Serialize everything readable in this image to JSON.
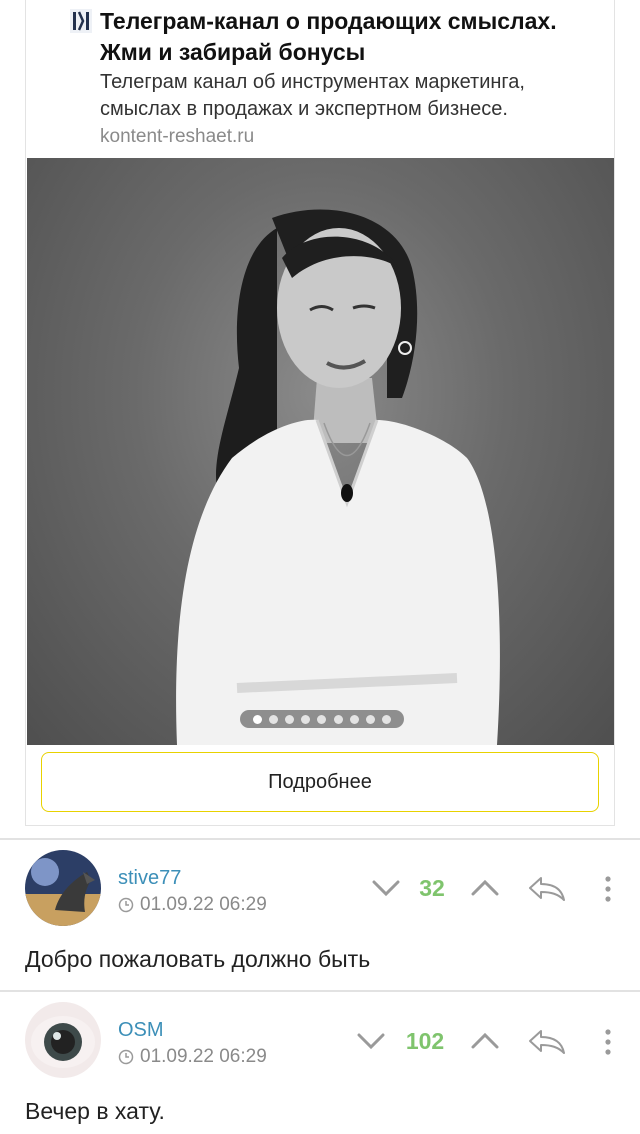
{
  "ad": {
    "title": "Телеграм-канал о продающих смыслах. Жми и забирай бонусы",
    "description": "Телеграм канал об инструментах маркетинга, смыслах в продажах и экспертном бизнесе.",
    "domain": "kontent-reshaet.ru",
    "button_label": "Подробнее",
    "carousel": {
      "count": 9,
      "active_index": 0
    }
  },
  "comments": [
    {
      "username": "stive77",
      "timestamp": "01.09.22 06:29",
      "score": "32",
      "text": "Добро пожаловать должно быть"
    },
    {
      "username": "OSM",
      "timestamp": "01.09.22 06:29",
      "score": "102",
      "text": "Вечер в хату."
    }
  ],
  "colors": {
    "username": "#3c8fb8",
    "score": "#7fc46d",
    "button_border": "#e8d200"
  }
}
